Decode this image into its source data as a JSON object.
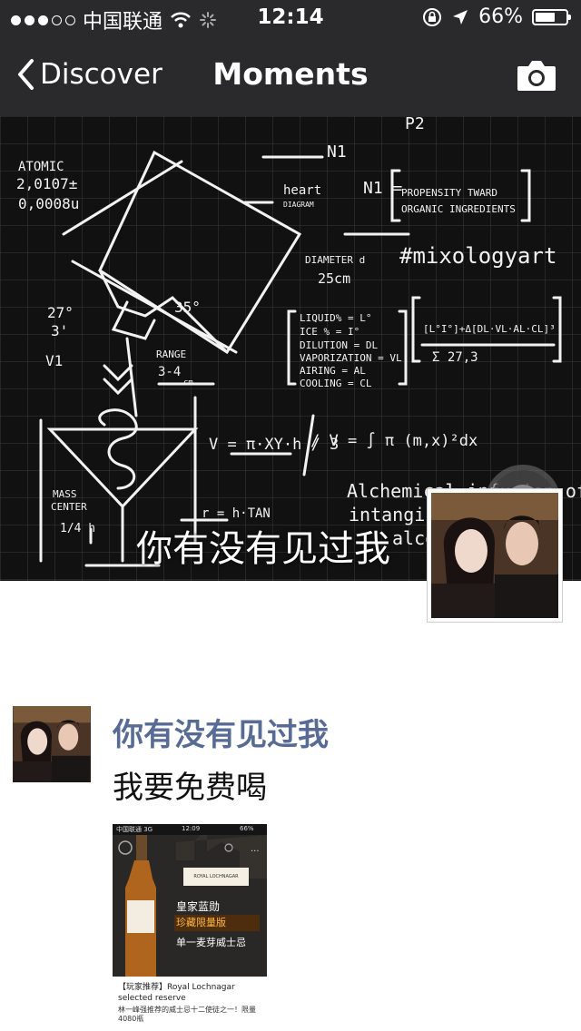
{
  "status_bar": {
    "carrier": "中国联通",
    "time": "12:14",
    "battery_text": "66%",
    "battery_level": 0.66
  },
  "nav": {
    "back_label": "Discover",
    "title": "Moments",
    "camera_icon": "camera-icon"
  },
  "cover": {
    "user_name": "你有没有见过我",
    "chalk_texts": {
      "atomic": "ATOMIC",
      "a1": "2,0107±",
      "a2": "0,0008u",
      "heart": "heart",
      "diagram": "DIAGRAM",
      "n1": "N1",
      "n1b": "N1 =",
      "propensity": "PROPENSITY TWARD",
      "organic": "ORGANIC INGREDIENTS",
      "p2": "P2",
      "hashtag": "#mixologyart",
      "diameter": "DIAMETER d",
      "cm25": "25cm",
      "deg27": "27°",
      "three": "3'",
      "deg35": "35°",
      "liquid": "LIQUID% = L°",
      "ice": "ICE % = I°",
      "dilution": "DILUTION = DL",
      "vapor": "VAPORIZATION = VL",
      "airing": "AIRING = AL",
      "cooling": "COOLING = CL",
      "formula1": "[L°I°]+Δ[DL·VL·AL·CL]³",
      "sigma": "Σ 27,3",
      "v1": "V1",
      "range": "RANGE",
      "range2": "3-4",
      "cm": "cm",
      "vformula": "V = π·XY·h / 3",
      "vformula2": "/ V = ∫ π (m,x)²dx",
      "alchemical": "Alchemical infusion of",
      "intangible": "intangible",
      "alcoh": "alcoh",
      "mass": "MASS",
      "center": "CENTER",
      "frac": "1/4 h",
      "rtan": "r = h·TAN"
    }
  },
  "post": {
    "author": "你有没有见过我",
    "text": "我要免费喝",
    "share": {
      "mini_status": {
        "carrier": "中国联通 3G",
        "time": "12:09",
        "battery": "66%"
      },
      "brand": "ROYAL LOCHNAGAR",
      "title_line1": "皇家蓝勋",
      "title_line2": "珍藏限量版",
      "title_line3": "单一麦芽威士忌",
      "caption": "【玩家推荐】Royal Lochnagar selected reserve",
      "description": "林一峰强推荐的威士忌十二使徒之一！限量4080瓶"
    }
  },
  "colors": {
    "topbar": "#2a2a2c",
    "link_blue": "#576b95",
    "chalk": "#ffffff",
    "board": "#111111"
  }
}
